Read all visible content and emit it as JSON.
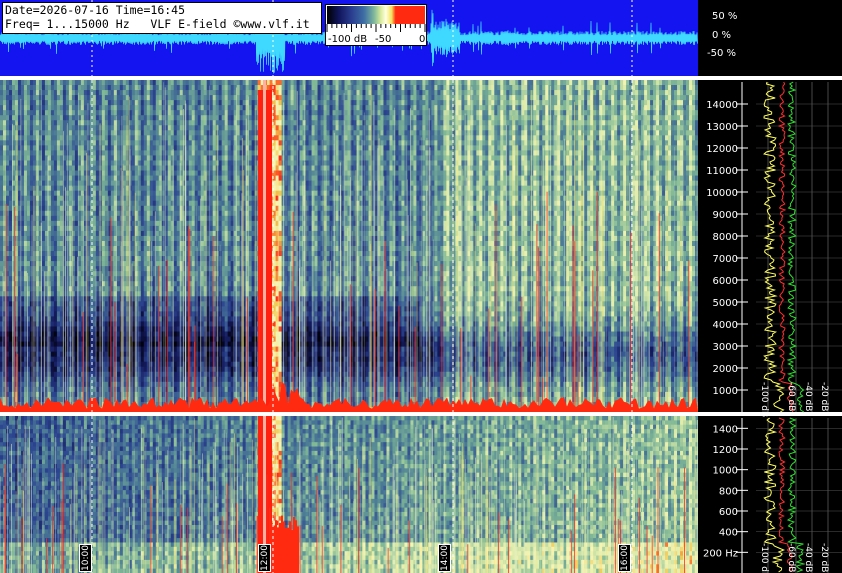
{
  "header": {
    "line1": "Date=2026-07-16 Time=16:45",
    "line2": "Freq= 1...15000 Hz   VLF E-field ©www.vlf.it"
  },
  "colorbar": {
    "labels": [
      "-100 dB",
      "-50",
      "0"
    ],
    "colors": [
      "#000000",
      "#2a3d8f",
      "#7fb79b",
      "#ffffe0",
      "#ff2a10"
    ]
  },
  "waveform": {
    "scale_labels": [
      "50 %",
      "0 %",
      "-50 %"
    ],
    "background": "#1414f0",
    "trace_color": "#3fd8ff"
  },
  "chart_data": [
    {
      "type": "heatmap",
      "title": "",
      "panel": "full-range",
      "y_unit": "Hz",
      "ylim": [
        0,
        15000
      ],
      "yticks": [
        "1000",
        "2000",
        "3000",
        "4000",
        "5000",
        "6000",
        "7000",
        "8000",
        "9000",
        "10000",
        "11000",
        "12000",
        "13000",
        "14000"
      ],
      "xticks": [
        "10:00",
        "12:00",
        "14:00",
        "16:00"
      ],
      "profile_axis_labels": [
        "-100 dB",
        "-60 dB",
        "-40 dB",
        "-20 dB"
      ]
    },
    {
      "type": "heatmap",
      "title": "",
      "panel": "low-frequency",
      "y_unit": "Hz",
      "ylim": [
        0,
        1500
      ],
      "yticks": [
        "200 Hz",
        "400",
        "600",
        "800",
        "1000",
        "1200",
        "1400"
      ],
      "xticks": [
        "10:00",
        "12:00",
        "14:00",
        "16:00"
      ],
      "profile_axis_labels": [
        "-100 dB",
        "-60 dB",
        "-40 dB",
        "-20 dB"
      ]
    }
  ]
}
